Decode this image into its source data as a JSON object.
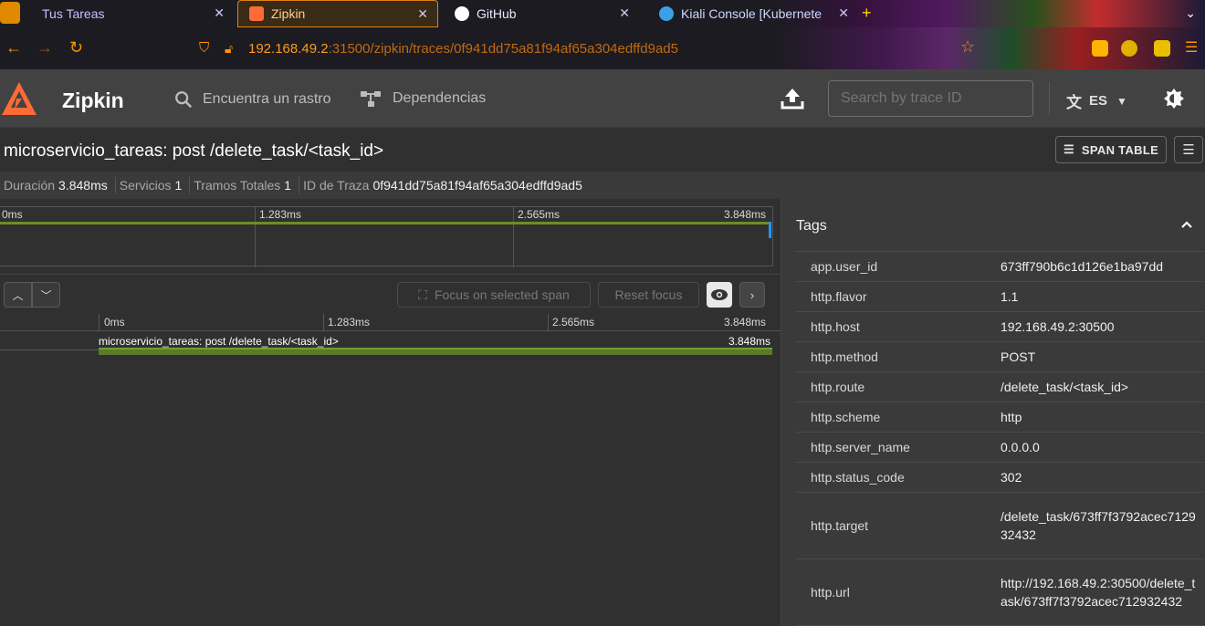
{
  "browser": {
    "tabs": [
      {
        "label": "Tus Tareas",
        "active": false
      },
      {
        "label": "Zipkin",
        "active": true
      },
      {
        "label": "GitHub",
        "active": false
      },
      {
        "label": "Kiali Console [Kubernete",
        "active": false
      }
    ],
    "url_host": "192.168.49.2",
    "url_rest": ":31500/zipkin/traces/0f941dd75a81f94af65a304edffd9ad5"
  },
  "header": {
    "brand": "Zipkin",
    "nav_find": "Encuentra un rastro",
    "nav_deps": "Dependencias",
    "search_placeholder": "Search by trace ID",
    "lang": "ES"
  },
  "trace": {
    "title": "microservicio_tareas: post /delete_task/<task_id>",
    "span_table_label": "SPAN TABLE",
    "summary": {
      "duration_label": "Duración",
      "duration_value": "3.848ms",
      "services_label": "Servicios",
      "services_value": "1",
      "spans_label": "Tramos Totales",
      "spans_value": "1",
      "traceid_label": "ID de Traza",
      "traceid_value": "0f941dd75a81f94af65a304edffd9ad5"
    },
    "ticks": [
      "0ms",
      "1.283ms",
      "2.565ms",
      "3.848ms"
    ],
    "focus_label": "Focus on selected span",
    "reset_label": "Reset focus",
    "span": {
      "name": "microservicio_tareas: post /delete_task/<task_id>",
      "duration": "3.848ms"
    }
  },
  "tags": {
    "heading": "Tags",
    "rows": [
      {
        "key": "app.user_id",
        "value": "673ff790b6c1d126e1ba97dd"
      },
      {
        "key": "http.flavor",
        "value": "1.1"
      },
      {
        "key": "http.host",
        "value": "192.168.49.2:30500"
      },
      {
        "key": "http.method",
        "value": "POST"
      },
      {
        "key": "http.route",
        "value": "/delete_task/<task_id>"
      },
      {
        "key": "http.scheme",
        "value": "http"
      },
      {
        "key": "http.server_name",
        "value": "0.0.0.0"
      },
      {
        "key": "http.status_code",
        "value": "302"
      },
      {
        "key": "http.target",
        "value": "/delete_task/673ff7f3792acec712932432"
      },
      {
        "key": "http.url",
        "value": "http://192.168.49.2:30500/delete_task/673ff7f3792acec712932432"
      }
    ]
  },
  "colors": {
    "accent": "#ff6b35",
    "span_bar": "#6b8e2a",
    "header_bg": "#424242"
  }
}
